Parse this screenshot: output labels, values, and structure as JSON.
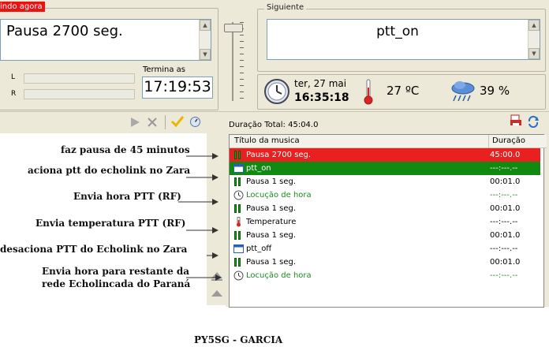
{
  "now_playing": {
    "title": "indo agora",
    "text": "Pausa 2700 seg."
  },
  "meters": {
    "left_label": "L",
    "right_label": "R"
  },
  "ends": {
    "label": "Termina as",
    "time": "17:19:53"
  },
  "next": {
    "title": "Siguiente",
    "text": "ptt_on"
  },
  "info": {
    "date": "ter, 27 mai",
    "time": "16:35:18",
    "temperature": "27 ºC",
    "humidity": "39 %"
  },
  "toolbar": {
    "total": "Duração Total: 45:04.0"
  },
  "playlist": {
    "col_title": "Título da musica",
    "col_duration": "Duração",
    "rows": [
      {
        "icon": "pause-icon",
        "title": "Pausa 2700 seg.",
        "duration": "45:00.0",
        "state": "playing"
      },
      {
        "icon": "window-icon",
        "title": "ptt_on",
        "duration": "---:---.--",
        "state": "next"
      },
      {
        "icon": "pause-icon",
        "title": "Pausa 1 seg.",
        "duration": "00:01.0",
        "state": "normal"
      },
      {
        "icon": "clock-icon",
        "title": "Locução de hora",
        "duration": "---:---.--",
        "state": "green"
      },
      {
        "icon": "pause-icon",
        "title": "Pausa 1 seg.",
        "duration": "00:01.0",
        "state": "normal"
      },
      {
        "icon": "thermometer-icon",
        "title": "Temperature",
        "duration": "---:---.--",
        "state": "normal"
      },
      {
        "icon": "pause-icon",
        "title": "Pausa 1 seg.",
        "duration": "00:01.0",
        "state": "normal"
      },
      {
        "icon": "window-icon",
        "title": "ptt_off",
        "duration": "---:---.--",
        "state": "normal"
      },
      {
        "icon": "pause-icon",
        "title": "Pausa 1 seg.",
        "duration": "00:01.0",
        "state": "normal"
      },
      {
        "icon": "clock-icon",
        "title": "Locução de hora",
        "duration": "---:---.--",
        "state": "green"
      }
    ]
  },
  "annotations": [
    "faz pausa de 45 minutos",
    "aciona ptt do echolink no Zara",
    "Envia hora PTT (RF)",
    "Envia temperatura PTT (RF)",
    "desaciona PTT do Echolink no Zara",
    "Envia hora para restante da",
    "rede Echolincada do Paraná"
  ],
  "footer": "PY5SG - GARCIA",
  "colors": {
    "playing_bg": "#e82020",
    "next_bg": "#128a12",
    "green_text": "#1e8b1e",
    "panel": "#ece9d8"
  }
}
